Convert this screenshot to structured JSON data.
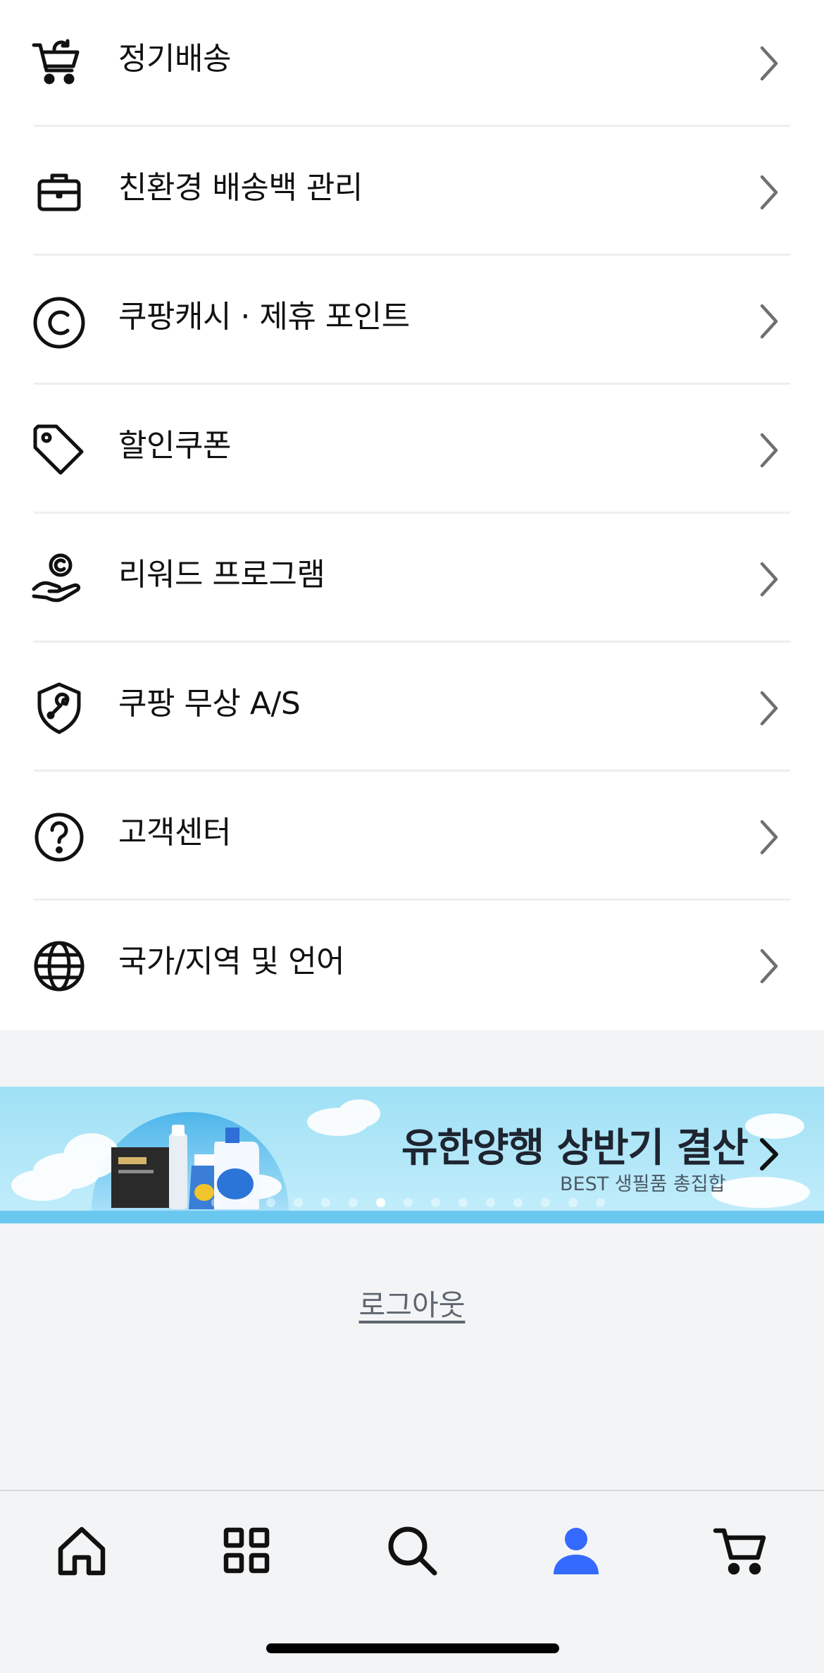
{
  "menu": {
    "items": [
      {
        "label": "정기배송",
        "icon": "subscription-cart-icon"
      },
      {
        "label": "친환경 배송백 관리",
        "icon": "eco-bag-icon"
      },
      {
        "label": "쿠팡캐시 · 제휴 포인트",
        "icon": "cash-c-icon"
      },
      {
        "label": "할인쿠폰",
        "icon": "tag-icon"
      },
      {
        "label": "리워드 프로그램",
        "icon": "reward-hand-icon"
      },
      {
        "label": "쿠팡 무상 A/S",
        "icon": "shield-wrench-icon"
      },
      {
        "label": "고객센터",
        "icon": "help-circle-icon"
      },
      {
        "label": "국가/지역 및 언어",
        "icon": "globe-icon"
      }
    ]
  },
  "banner": {
    "title": "유한양행 상반기 결산",
    "subtitle": "BEST 생필품 총집합",
    "page_count": 15,
    "active_page": 6
  },
  "logout_label": "로그아웃",
  "tabbar": {
    "tabs": [
      {
        "name": "home",
        "icon": "home-icon"
      },
      {
        "name": "categories",
        "icon": "category-grid-icon"
      },
      {
        "name": "search",
        "icon": "search-icon"
      },
      {
        "name": "my-coupang",
        "icon": "user-icon",
        "active": true
      },
      {
        "name": "cart",
        "icon": "cart-icon"
      }
    ],
    "active_color": "#346aff",
    "inactive_color": "#111111"
  }
}
